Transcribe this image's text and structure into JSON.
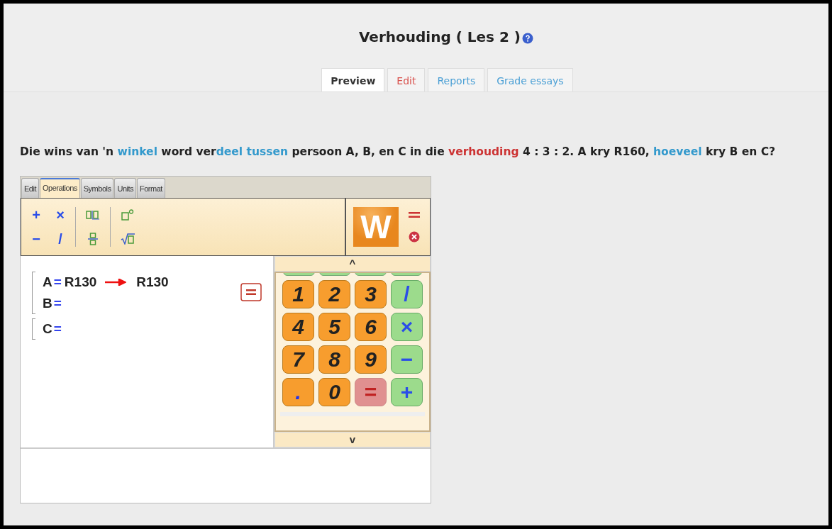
{
  "title": "Verhouding ( Les 2 )",
  "tabs": [
    {
      "label": "Preview",
      "selected": true,
      "color": "#333333"
    },
    {
      "label": "Edit",
      "selected": false,
      "color": "#d9534f"
    },
    {
      "label": "Reports",
      "selected": false,
      "color": "#4a9fd5"
    },
    {
      "label": "Grade essays",
      "selected": false,
      "color": "#4a9fd5"
    }
  ],
  "question": [
    {
      "text": "Die wins van 'n ",
      "color": "#222222"
    },
    {
      "text": "winkel",
      "color": "#3399cc"
    },
    {
      "text": " word ver",
      "color": "#222222"
    },
    {
      "text": "deel tussen",
      "color": "#3399cc"
    },
    {
      "text": " persoon A, B, en C in die ",
      "color": "#222222"
    },
    {
      "text": "verhouding",
      "color": "#cc3333"
    },
    {
      "text": " 4 : 3 : 2.  A kry R160, ",
      "color": "#222222"
    },
    {
      "text": "hoeveel",
      "color": "#3399cc"
    },
    {
      "text": " kry B en C?",
      "color": "#222222"
    }
  ],
  "editor": {
    "tabs": [
      {
        "label": "Edit",
        "selected": false
      },
      {
        "label": "Operations",
        "selected": true
      },
      {
        "label": "Symbols",
        "selected": false
      },
      {
        "label": "Units",
        "selected": false
      },
      {
        "label": "Format",
        "selected": false
      }
    ],
    "operators": [
      "+",
      "×",
      "−",
      "/"
    ],
    "logo": "W",
    "groups": [
      {
        "lines": [
          {
            "variable": "A",
            "sign": "=",
            "value": "R130",
            "result": "R130"
          },
          {
            "variable": "B",
            "sign": "="
          }
        ]
      },
      {
        "lines": [
          {
            "variable": "C",
            "sign": "="
          }
        ]
      }
    ],
    "scroll_up": "^",
    "scroll_down": "v",
    "keys": [
      {
        "label": "1",
        "kind": "digit"
      },
      {
        "label": "2",
        "kind": "digit"
      },
      {
        "label": "3",
        "kind": "digit"
      },
      {
        "label": "/",
        "kind": "op"
      },
      {
        "label": "4",
        "kind": "digit"
      },
      {
        "label": "5",
        "kind": "digit"
      },
      {
        "label": "6",
        "kind": "digit"
      },
      {
        "label": "×",
        "kind": "op"
      },
      {
        "label": "7",
        "kind": "digit"
      },
      {
        "label": "8",
        "kind": "digit"
      },
      {
        "label": "9",
        "kind": "digit"
      },
      {
        "label": "−",
        "kind": "op"
      },
      {
        "label": ".",
        "kind": "point"
      },
      {
        "label": "0",
        "kind": "digit"
      },
      {
        "label": "=",
        "kind": "equals"
      },
      {
        "label": "+",
        "kind": "op"
      }
    ]
  }
}
